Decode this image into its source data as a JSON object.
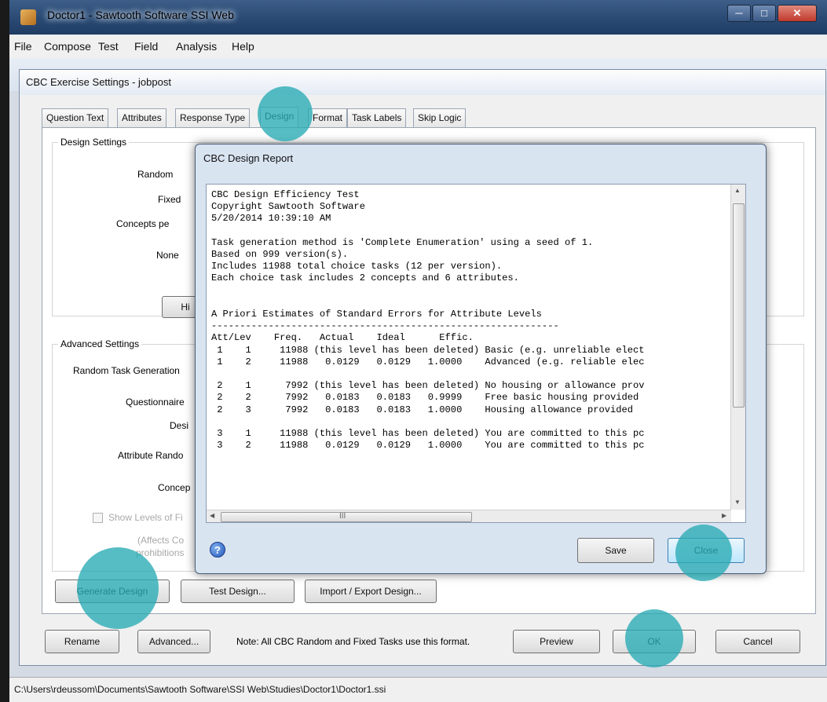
{
  "app": {
    "title": "Doctor1 - Sawtooth Software SSI Web"
  },
  "menu": [
    "File",
    "Compose",
    "Test",
    "Field",
    "Analysis",
    "Help"
  ],
  "dialog": {
    "title": "CBC Exercise Settings - jobpost",
    "tabs": [
      "Question Text",
      "Attributes",
      "Response Type",
      "Design",
      "Format",
      "Task Labels",
      "Skip Logic"
    ],
    "active_tab": "Design",
    "design_settings": {
      "title": "Design Settings",
      "random_label": "Random",
      "fixed_label": "Fixed",
      "concepts_label": "Concepts pe",
      "none_label": "None",
      "hi_button": "Hi"
    },
    "advanced_settings": {
      "title": "Advanced Settings",
      "random_task_generation": "Random Task Generation",
      "questionnaire_label": "Questionnaire",
      "design_label": "Desi",
      "attribute_random_label": "Attribute Rando",
      "concept_label": "Concep",
      "show_levels": "Show Levels of Fi",
      "affects_note_1": "(Affects Co",
      "affects_note_2": "prohibitions"
    },
    "buttons": {
      "generate_design": "Generate Design",
      "test_design": "Test Design...",
      "import_export": "Import / Export Design...",
      "rename": "Rename",
      "advanced": "Advanced...",
      "preview": "Preview",
      "ok": "OK",
      "cancel": "Cancel"
    },
    "note": "Note:  All CBC Random and Fixed Tasks use this format."
  },
  "report": {
    "title": "CBC Design Report",
    "lines": [
      "CBC Design Efficiency Test",
      "Copyright Sawtooth Software",
      "5/20/2014 10:39:10 AM",
      "",
      "Task generation method is 'Complete Enumeration' using a seed of 1.",
      "Based on 999 version(s).",
      "Includes 11988 total choice tasks (12 per version).",
      "Each choice task includes 2 concepts and 6 attributes.",
      "",
      "",
      "A Priori Estimates of Standard Errors for Attribute Levels",
      "-------------------------------------------------------------",
      "Att/Lev    Freq.   Actual    Ideal      Effic.",
      " 1    1     11988 (this level has been deleted) Basic (e.g. unreliable elect",
      " 1    2     11988   0.0129   0.0129   1.0000    Advanced (e.g. reliable elec",
      "",
      " 2    1      7992 (this level has been deleted) No housing or allowance prov",
      " 2    2      7992   0.0183   0.0183   0.9999    Free basic housing provided",
      " 2    3      7992   0.0183   0.0183   1.0000    Housing allowance provided",
      "",
      " 3    1     11988 (this level has been deleted) You are committed to this pc",
      " 3    2     11988   0.0129   0.0129   1.0000    You are committed to this pc"
    ],
    "buttons": {
      "save": "Save",
      "close": "Close"
    },
    "hscroll_grip": "III"
  },
  "status_bar": "C:\\Users\\rdeussom\\Documents\\Sawtooth Software\\SSI Web\\Studies\\Doctor1\\Doctor1.ssi",
  "colors": {
    "highlight": "#28aab4",
    "titlebar": "#2a4a74"
  },
  "icons": [
    "app-icon",
    "minimize-icon",
    "maximize-icon",
    "close-window-icon",
    "help-icon",
    "checkbox-icon",
    "scroll-arrow-icon"
  ]
}
